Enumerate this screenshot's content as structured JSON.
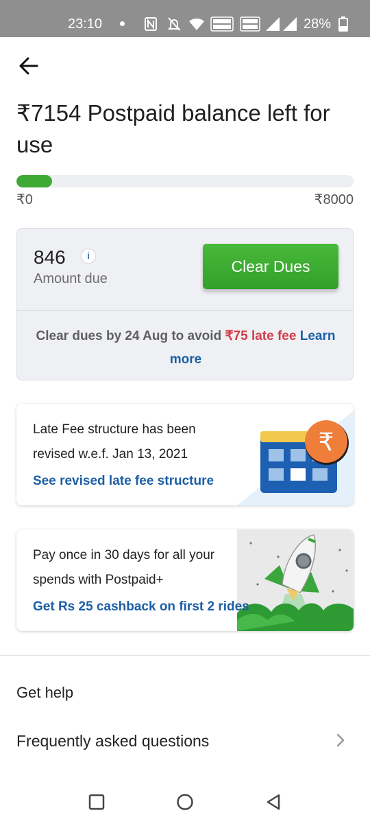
{
  "status_bar": {
    "time": "23:10",
    "battery_percent": "28%",
    "icons": [
      "nfc-icon",
      "mute-icon",
      "wifi-icon",
      "volte-wifi-icon",
      "volte-lte-icon",
      "signal-icon",
      "signal-x-icon",
      "battery-icon"
    ]
  },
  "header": {
    "back_icon": "arrow-left-icon",
    "title": "₹7154 Postpaid balance left for use"
  },
  "balance": {
    "used_fraction": 0.106,
    "min_label": "₹0",
    "max_label": "₹8000",
    "fill_color": "#3fa935"
  },
  "due_card": {
    "amount": "846",
    "amount_label": "Amount due",
    "info_icon": "i",
    "clear_button": "Clear Dues",
    "note_prefix": "Clear dues by 24 Aug to avoid",
    "note_fee": "₹75 late fee",
    "note_link": "Learn more"
  },
  "late_fee_card": {
    "text": "Late Fee structure has been revised w.e.f. Jan 13, 2021",
    "link": "See revised late fee structure",
    "illustration": "calendar-rupee-icon"
  },
  "postpaid_plus_card": {
    "text": "Pay once in 30 days for all your spends with Postpaid+",
    "link": "Get Rs 25 cashback on first 2 rides",
    "illustration": "rocket-icon"
  },
  "help": {
    "title": "Get help",
    "faq_label": "Frequently asked questions"
  },
  "colors": {
    "accent_green": "#3fa935",
    "link_blue": "#1c5fa6",
    "late_fee_red": "#d13c4a"
  }
}
